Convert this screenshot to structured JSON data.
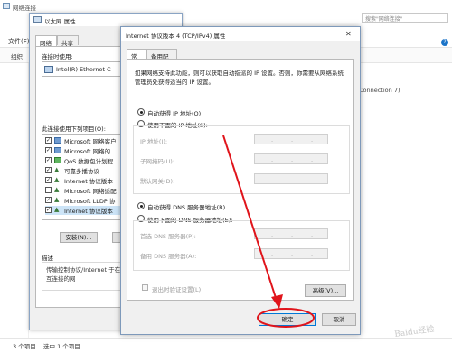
{
  "background": {
    "window_title": "网络连接",
    "menu_file": "文件(F)",
    "toolbar_org": "组织",
    "search_placeholder": "搜索\"网络连接\"",
    "connection_label": "Connection 7)",
    "status_items": "3 个项目",
    "status_selected": "选中 1 个项目"
  },
  "ethernet": {
    "title": "以太网 属性",
    "tabs": [
      "网络",
      "共享"
    ],
    "connect_using_label": "连接时使用:",
    "adapter_name": "Intel(R) Ethernet C",
    "items_label": "此连接使用下列项目(O):",
    "items": [
      {
        "label": "Microsoft 网络客户",
        "checked": true
      },
      {
        "label": "Microsoft 网络的",
        "checked": true
      },
      {
        "label": "QoS 数据包计划程",
        "checked": true
      },
      {
        "label": "可靠多播协议",
        "checked": true
      },
      {
        "label": "Internet 协议版本",
        "checked": true
      },
      {
        "label": "Microsoft 网络适配",
        "checked": false
      },
      {
        "label": "Microsoft LLDP 协",
        "checked": true
      },
      {
        "label": "Internet 协议版本",
        "checked": true
      }
    ],
    "install_button": "安装(N)...",
    "description_label": "描述",
    "description_text": "传输控制协议/Internet 于在不同的相互连接的网"
  },
  "ipv4": {
    "title": "Internet 协议版本 4 (TCP/IPv4) 属性",
    "close_glyph": "✕",
    "tabs": [
      "常规",
      "备用配置"
    ],
    "intro": "如果网络支持此功能，则可以获取自动指派的 IP 设置。否则，你需要从网络系统管理员处获得适当的 IP 设置。",
    "auto_ip_label": "自动获得 IP 地址(O)",
    "manual_ip_label": "使用下面的 IP 地址(S):",
    "ip_address_label": "IP 地址(I):",
    "subnet_label": "子网掩码(U):",
    "gateway_label": "默认网关(D):",
    "auto_dns_label": "自动获得 DNS 服务器地址(B)",
    "manual_dns_label": "使用下面的 DNS 服务器地址(E):",
    "preferred_dns_label": "首选 DNS 服务器(P):",
    "alternate_dns_label": "备用 DNS 服务器(A):",
    "validate_label": "退出时验证设置(L)",
    "advanced_button": "高级(V)...",
    "ok_button": "确定",
    "cancel_button": "取消",
    "ip_dot": "."
  },
  "watermark": "Baidu经验",
  "colors": {
    "annotation_red": "#e0141b",
    "accent_blue": "#0078d7"
  }
}
